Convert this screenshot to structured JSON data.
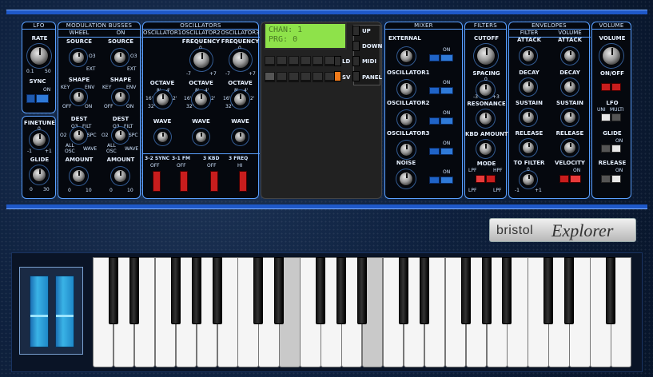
{
  "lfo": {
    "title": "LFO",
    "rate": "RATE",
    "range_min": "0.1",
    "range_max": "50",
    "sync": "SYNC",
    "sync_on": "ON",
    "finetune": "FINETUNE",
    "finetune_zero": "0",
    "finetune_min": "-1",
    "finetune_max": "+1",
    "glide": "GLIDE",
    "glide_min": "0",
    "glide_max": "30"
  },
  "mod": {
    "title": "MODULATION BUSSES",
    "wheel": "WHEEL",
    "on": "ON",
    "source": "SOURCE",
    "osc3": "O3",
    "ext": "EXT",
    "shape": "SHAPE",
    "key": "KEY",
    "env": "ENV",
    "off": "OFF",
    "dest": "DEST",
    "filt": "FILT",
    "spc": "SPC",
    "all": "ALL",
    "osc": "OSC",
    "wave": "WAVE",
    "o2": "O2",
    "amount": "AMOUNT",
    "amt_min": "0",
    "amt_max": "10"
  },
  "osc": {
    "title": "OSCILLATORS",
    "osc1": "OSCILLATOR1",
    "osc2": "OSCILLATOR2",
    "osc3": "OSCILLATOR3",
    "frequency": "FREQUENCY",
    "freq_zero": "0",
    "freq_min": "-7",
    "freq_max": "+7",
    "octave": "OCTAVE",
    "oct8": "8'",
    "oct4": "4'",
    "oct16": "16'",
    "oct2": "2'",
    "oct32": "32'",
    "wave": "WAVE",
    "sync": "3-2 SYNC",
    "fm": "3-1 FM",
    "kbd": "3 KBD",
    "freq": "3 FREQ",
    "btn_off": "OFF",
    "btn_hi": "HI"
  },
  "display": {
    "line1": "CHAN: 1",
    "line2": "PRG: 0",
    "up": "UP",
    "down": "DOWN",
    "ld": "LD",
    "midi": "MIDI",
    "sv": "SV",
    "panel": "PANEL"
  },
  "mixer": {
    "title": "MIXER",
    "external": "EXTERNAL",
    "osc1": "OSCILLATOR1",
    "osc2": "OSCILLATOR2",
    "osc3": "OSCILLATOR3",
    "noise": "NOISE",
    "on": "ON"
  },
  "filters": {
    "title": "FILTERS",
    "cutoff": "CUTOFF",
    "spacing": "SPACING",
    "sp_zero": "0",
    "sp_min": "-3",
    "sp_max": "+3",
    "resonance": "RESONANCE",
    "kbd_amount": "KBD AMOUNT",
    "mode": "MODE",
    "lpf": "LPF",
    "hpf": "HPF",
    "lpf2": "LPF",
    "lpf3": "LPF"
  },
  "envelopes": {
    "title": "ENVELOPES",
    "filter": "FILTER",
    "volume": "VOLUME",
    "attack": "ATTACK",
    "decay": "DECAY",
    "sustain": "SUSTAIN",
    "release": "RELEASE",
    "to_filter": "TO FILTER",
    "tf_zero": "0",
    "tf_min": "-1",
    "tf_max": "+1",
    "velocity": "VELOCITY",
    "on": "ON"
  },
  "volume": {
    "title": "VOLUME",
    "volume": "VOLUME",
    "onoff": "ON/OFF",
    "lfo": "LFO",
    "uni": "UNI",
    "multi": "MULTI",
    "glide": "GLIDE",
    "release": "RELEASE",
    "on": "ON"
  },
  "brand": {
    "left": "bristol",
    "right": "Explorer"
  }
}
